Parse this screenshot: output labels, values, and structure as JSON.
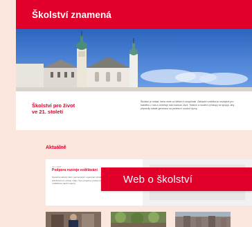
{
  "hero": {
    "title": "Školství znamená"
  },
  "intro": {
    "heading": "Školství pro život\nve 21. století",
    "text": "Školství je oblast, která vede od dětství k dospělosti. Základní vzdělání je nezbytné pro každého z nás a ovlivňuje náš budoucí život. Tradice a moderní přístupy se spojují, aby připravily mladé generace na profesní i osobní výzvy."
  },
  "news": {
    "heading": "Aktuálně",
    "card": {
      "meta": "20.1.2025",
      "title": "Podpora rozvoje vzdělávání",
      "excerpt": "Společné aktivity škol i partnerských organizací přinášejí nové projekty, inovace a příležitosti pro učitele i žáky. Tyto programy posilují spolupráci, zkušenosti a rozvoj vzdělávání napříč regiony."
    }
  },
  "overlay": {
    "text": "Web o školství"
  },
  "colors": {
    "brand": "#e1002a",
    "background": "#fbe6dd"
  }
}
